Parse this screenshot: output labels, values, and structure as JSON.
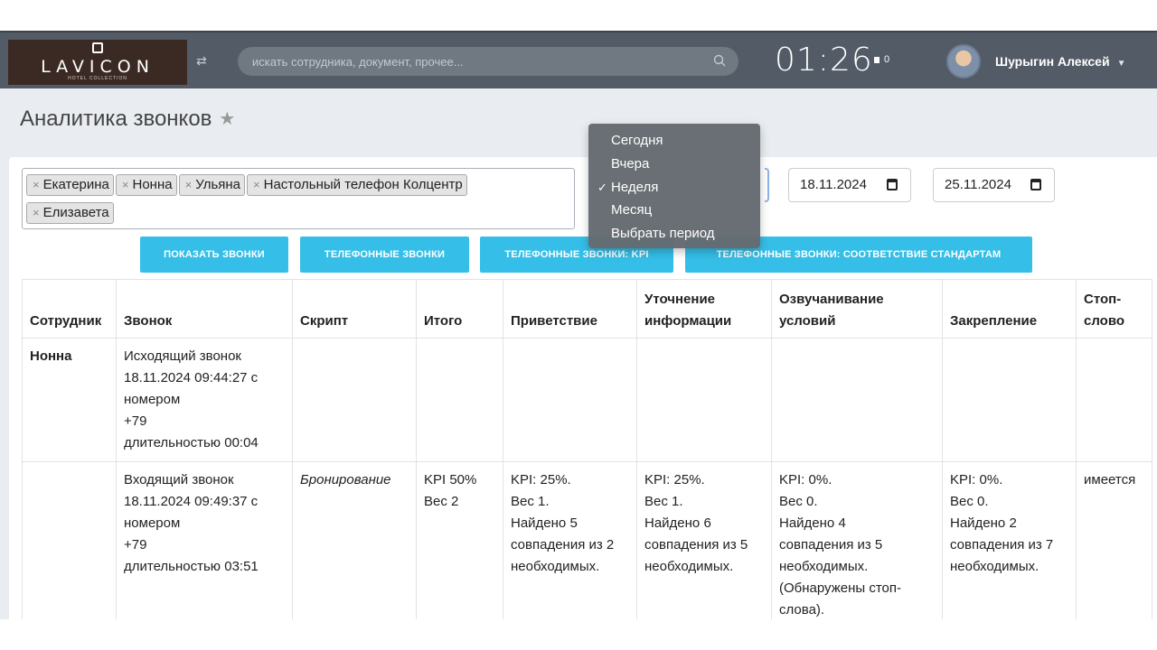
{
  "header": {
    "logo_text": "LAVICON",
    "logo_subtext": "HOTEL COLLECTION",
    "search_placeholder": "искать сотрудника, документ, прочее...",
    "clock": "01:26",
    "flag_count": "0",
    "user_name": "Шурыгин Алексей"
  },
  "page": {
    "title": "Аналитика звонков"
  },
  "filters": {
    "tags": [
      "Екатерина",
      "Нонна",
      "Ульяна",
      "Настольный телефон Колцентр",
      "Елизавета"
    ],
    "date_from": "18.11.2024",
    "date_to": "25.11.2024",
    "period_options": [
      "Сегодня",
      "Вчера",
      "Неделя",
      "Месяц",
      "Выбрать период"
    ],
    "period_selected": "Неделя"
  },
  "buttons": {
    "show_calls": "ПОКАЗАТЬ ЗВОНКИ",
    "phone_calls": "ТЕЛЕФОННЫЕ ЗВОНКИ",
    "phone_calls_kpi": "ТЕЛЕФОННЫЕ ЗВОНКИ: KPI",
    "phone_calls_standards": "ТЕЛЕФОННЫЕ ЗВОНКИ: СООТВЕТСТВИЕ СТАНДАРТАМ"
  },
  "table": {
    "headers": [
      "Сотрудник",
      "Звонок",
      "Скрипт",
      "Итого",
      "Приветствие",
      "Уточнение информации",
      "Озвучанивание условий",
      "Закрепление",
      "Стоп-слово"
    ],
    "rows": [
      {
        "employee": "Нонна",
        "call": [
          "Исходящий звонок",
          "18.11.2024 09:44:27 с",
          "номером",
          "+79",
          "длительностью 00:04"
        ],
        "script": "",
        "total": [],
        "greeting": [],
        "clarification": [],
        "conditions": [],
        "closing": [],
        "stopword": ""
      },
      {
        "employee": "",
        "call": [
          "Входящий звонок",
          "18.11.2024 09:49:37 с",
          "номером",
          "+79",
          "длительностью 03:51"
        ],
        "script": "Бронирование",
        "total": [
          "KPI 50%",
          "Вес 2"
        ],
        "greeting": [
          "KPI: 25%.",
          "Вес 1.",
          "Найдено 5",
          "совпадения из 2",
          "необходимых."
        ],
        "clarification": [
          "KPI: 25%.",
          "Вес 1.",
          "Найдено 6",
          "совпадения из 5",
          "необходимых."
        ],
        "conditions": [
          "KPI: 0%.",
          "Вес 0.",
          "Найдено 4",
          "совпадения из 5",
          "необходимых.",
          "(Обнаружены стоп-",
          "слова)."
        ],
        "closing": [
          "KPI: 0%.",
          "Вес 0.",
          "Найдено 2",
          "совпадения из 7",
          "необходимых."
        ],
        "stopword": "имеется"
      }
    ]
  }
}
